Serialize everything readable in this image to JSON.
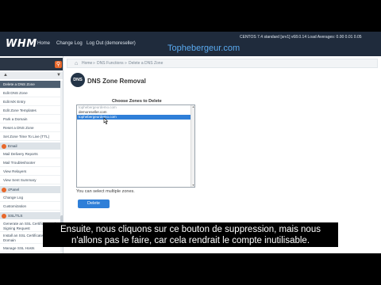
{
  "topbar": {
    "logo": "WHM",
    "nav": [
      "Home",
      "Change Log",
      "Log Out (demoreseller)"
    ],
    "watermark": "Tophebergeur.com",
    "system_info": "CENTOS 7.4 standard [srv1]   v68.0.14   Load Averages: 0.00 0.01 0.05"
  },
  "sidebar": {
    "items_top": [
      "Delete a DNS Zone",
      "Edit DNS Zone",
      "Edit MX Entry",
      "Edit Zone Templates",
      "Park a Domain",
      "Reset a DNS Zone",
      "Set Zone Time To Live (TTL)"
    ],
    "section_email": "Email",
    "items_email": [
      "Mail Delivery Reports",
      "Mail Troubleshooter",
      "View Relayers",
      "View Sent Summary"
    ],
    "section_cpanel": "cPanel",
    "items_cpanel": [
      "Change Log",
      "Customization"
    ],
    "section_ssl": "SSL/TLS",
    "items_ssl": [
      "Generate an SSL Certificate and Signing Request",
      "Install an SSL Certificate on a Domain",
      "Manage SSL Hosts"
    ]
  },
  "breadcrumb": {
    "home": "Home",
    "section": "DNS Functions",
    "page": "Delete a DNS Zone"
  },
  "page": {
    "icon_text": "DNS",
    "title": "DNS Zone Removal"
  },
  "form": {
    "choose_label": "Choose Zones to Delete",
    "options": [
      "tophebergeurdemo.com",
      "demoreseller.com",
      "tophebergeurdemo.com"
    ],
    "selected_index": 2,
    "help_text": "You can select multiple zones.",
    "delete_label": "Delete"
  },
  "subtitle": {
    "line1": "Ensuite, nous cliquons sur ce bouton de suppression, mais nous",
    "line2": "n'allons pas le faire, car cela rendrait le compte inutilisable."
  },
  "colors": {
    "topbar": "#1f2b3c",
    "accent": "#e8682b",
    "selection": "#2f7fd8",
    "watermark": "#5aaaf0"
  }
}
